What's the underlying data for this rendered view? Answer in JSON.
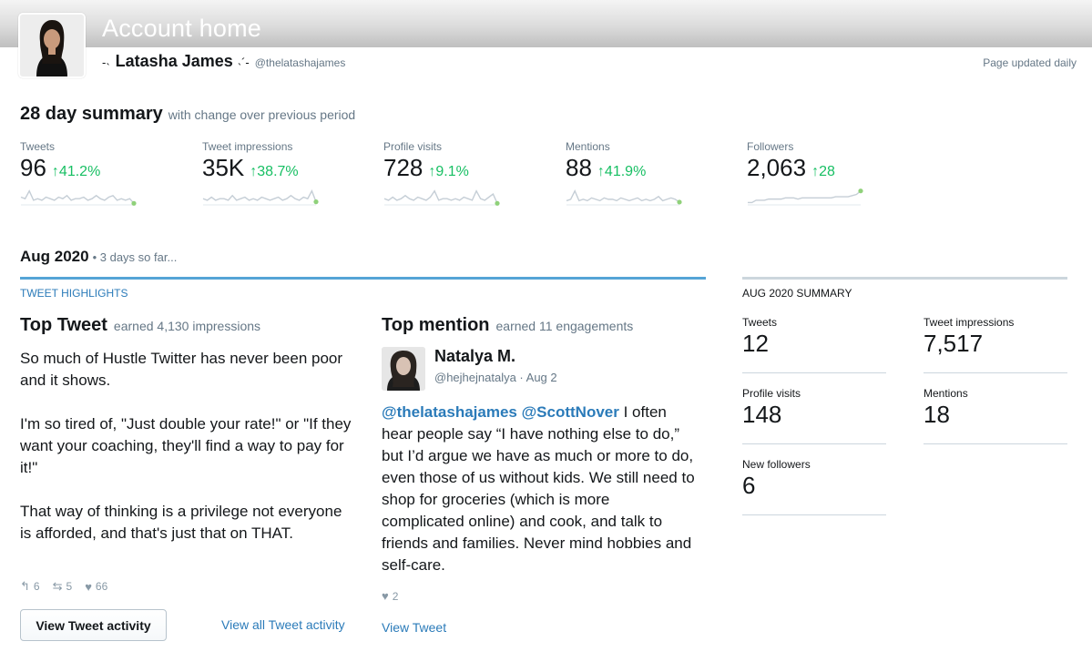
{
  "header": {
    "title": "Account home",
    "user_name": "Latasha James",
    "user_handle": "@thelatashajames",
    "updated_note": "Page updated daily",
    "sparkle_left": "-˴",
    "sparkle_right": "˴´-"
  },
  "summary": {
    "title": "28 day summary",
    "subtitle": "with change over previous period",
    "stats": [
      {
        "label": "Tweets",
        "value": "96",
        "change": "41.2%",
        "trend": [
          5,
          4,
          9,
          3,
          4,
          3,
          5,
          4,
          3,
          5,
          4,
          6,
          3,
          4,
          4,
          5,
          3,
          4,
          6,
          4,
          3,
          5,
          6,
          3,
          4,
          3,
          4,
          1
        ]
      },
      {
        "label": "Tweet impressions",
        "value": "35K",
        "change": "38.7%",
        "trend": [
          4,
          3,
          5,
          3,
          4,
          4,
          3,
          6,
          3,
          4,
          5,
          3,
          4,
          3,
          5,
          4,
          3,
          4,
          5,
          3,
          4,
          6,
          4,
          3,
          5,
          4,
          9,
          2
        ]
      },
      {
        "label": "Profile visits",
        "value": "728",
        "change": "9.1%",
        "trend": [
          4,
          3,
          5,
          3,
          4,
          6,
          4,
          3,
          5,
          4,
          3,
          5,
          9,
          3,
          4,
          4,
          3,
          4,
          3,
          5,
          4,
          3,
          9,
          4,
          3,
          5,
          7,
          1
        ]
      },
      {
        "label": "Mentions",
        "value": "88",
        "change": "41.9%",
        "trend": [
          3,
          4,
          10,
          3,
          4,
          3,
          5,
          4,
          3,
          5,
          4,
          4,
          3,
          5,
          4,
          3,
          4,
          5,
          3,
          4,
          3,
          4,
          6,
          3,
          4,
          5,
          4,
          2
        ]
      },
      {
        "label": "Followers",
        "value": "2,063",
        "change": "28",
        "trend": [
          2,
          2,
          4,
          4,
          4,
          5,
          5,
          5,
          5,
          6,
          6,
          6,
          5,
          6,
          6,
          6,
          6,
          6,
          6,
          6,
          6,
          7,
          7,
          7,
          7,
          8,
          9,
          12
        ]
      }
    ],
    "up_arrow": "↑"
  },
  "month": {
    "title": "Aug 2020",
    "subtitle": "• 3 days so far..."
  },
  "highlights": {
    "label": "TWEET HIGHLIGHTS",
    "top_tweet": {
      "title": "Top Tweet",
      "subtitle": "earned 4,130 impressions",
      "paragraphs": [
        "So much of Hustle Twitter has never been poor and it shows.",
        "I'm so tired of, \"Just double your rate!\" or \"If they want your coaching, they'll find a way to pay for it!\"",
        "That way of thinking is a privilege not everyone is afforded, and that's just that on THAT."
      ],
      "replies": "6",
      "retweets": "5",
      "likes": "66",
      "button_label": "View Tweet activity",
      "link_label": "View all Tweet activity"
    },
    "top_mention": {
      "title": "Top mention",
      "subtitle": "earned 11 engagements",
      "name": "Natalya M.",
      "handle_date": "@hejhejnatalya · Aug 2",
      "mention1": "@thelatashajames",
      "mention2": "@ScottNover",
      "text": " I often hear people say “I have nothing else to do,” but I’d argue we have as much or more to do, even those of us without kids. We still need to shop for groceries (which is more complicated online) and cook, and talk to friends and families. Never mind hobbies and self-care.",
      "likes": "2",
      "link_label": "View Tweet"
    }
  },
  "month_summary": {
    "label": "AUG 2020 SUMMARY",
    "items": [
      {
        "label": "Tweets",
        "value": "12"
      },
      {
        "label": "Tweet impressions",
        "value": "7,517"
      },
      {
        "label": "Profile visits",
        "value": "148"
      },
      {
        "label": "Mentions",
        "value": "18"
      },
      {
        "label": "New followers",
        "value": "6"
      }
    ]
  },
  "colors": {
    "positive": "#17bf63",
    "link": "#2b7bb9",
    "accent_bar": "#55a4d6",
    "spark_line": "#c5ced6",
    "spark_dot": "#8fd17a"
  },
  "icons": {
    "reply": "reply-icon",
    "retweet": "retweet-icon",
    "like": "heart-icon"
  }
}
